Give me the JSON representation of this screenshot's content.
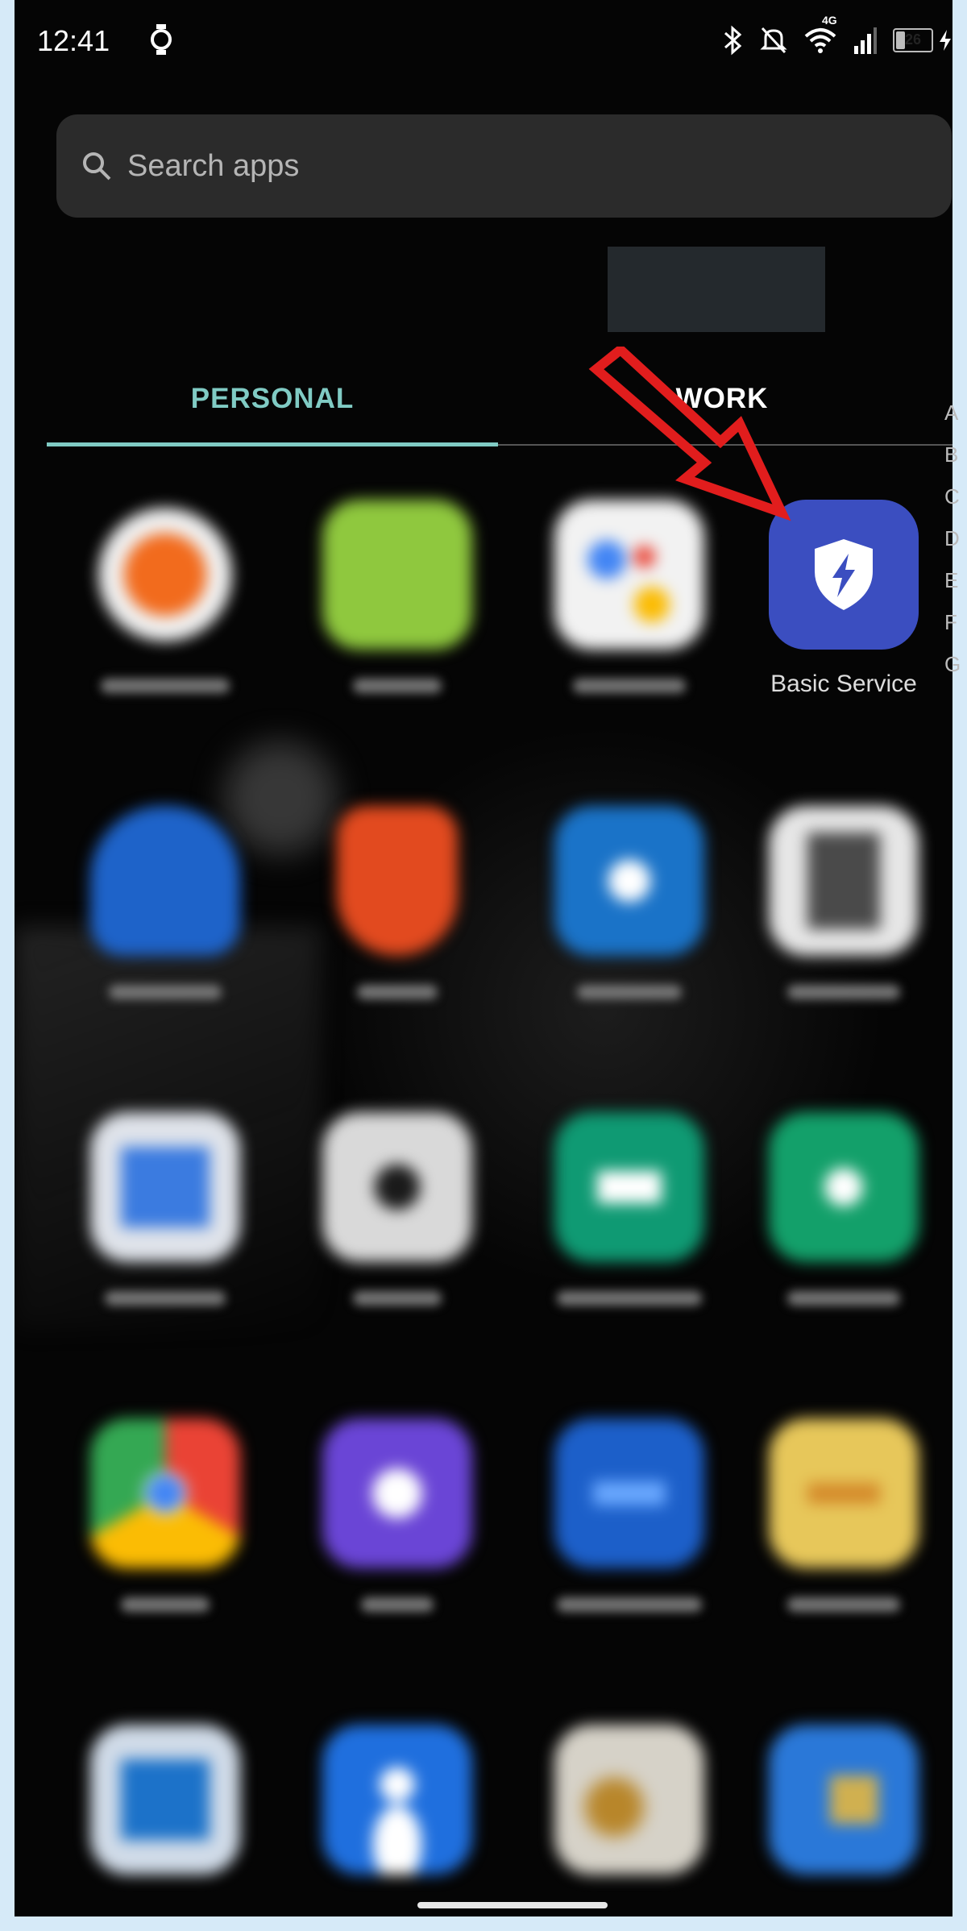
{
  "status_bar": {
    "time": "12:41",
    "network_label": "4G",
    "battery_level": "26",
    "battery_fraction": 0.26,
    "icons": [
      "watch-icon",
      "bluetooth-icon",
      "mute-bell-icon",
      "wifi-icon",
      "signal-icon",
      "battery-icon",
      "charging-icon"
    ]
  },
  "search": {
    "placeholder": "Search apps",
    "value": ""
  },
  "tabs": [
    {
      "label": "PERSONAL",
      "active": true
    },
    {
      "label": "WORK",
      "active": false
    }
  ],
  "alphabet_index": [
    "A",
    "B",
    "C",
    "D",
    "E",
    "F",
    "G"
  ],
  "apps": {
    "featured": {
      "label": "Basic Service",
      "icon": "shield-lightning-icon",
      "color": "#3b4ec0"
    }
  },
  "colors": {
    "accent": "#80cbc4",
    "background": "#050505",
    "arrow": "#e11d1d"
  }
}
